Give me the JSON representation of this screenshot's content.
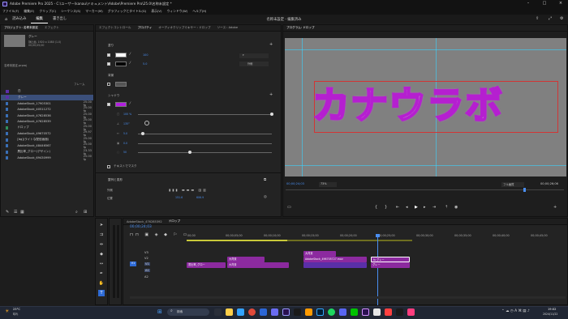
{
  "window": {
    "title": "Adobe Premiere Pro 2025 - C:\\ユーザー\\kanau\\ドキュメント\\Adobe\\Premiere Pro\\25.0\\名称未設定 *"
  },
  "menu": [
    "ファイル(F)",
    "編集(E)",
    "クリップ(C)",
    "シーケンス(S)",
    "マーカー(M)",
    "グラフィックとタイトル(G)",
    "表示(V)",
    "ウィンドウ(W)",
    "ヘルプ(H)"
  ],
  "workspace": {
    "tabs": [
      "読み込み",
      "編集",
      "書き出し"
    ],
    "center_title": "名称未設定 - 編集済み"
  },
  "project": {
    "tabs": [
      "プロジェクト: 名称未設定",
      "エフェクト"
    ],
    "preview_name": "グレー",
    "preview_info": "静止画, 1920 x 1080 (1.0)",
    "preview_duration": "00;00;05;00",
    "project_file": "名称未設定.prproj",
    "col_header": "フレーム",
    "items": [
      {
        "name": "白",
        "fps": "",
        "color": "#5b2fa8"
      },
      {
        "name": "グレー",
        "fps": "",
        "color": "#5b2fa8"
      },
      {
        "name": "AdobeStock_179053015",
        "fps": "25.00 fp",
        "color": "#3a6fb5"
      },
      {
        "name": "AdobeStock_405112725",
        "fps": "25.00 fp",
        "color": "#3a6fb5"
      },
      {
        "name": "AdobeStock_476285361",
        "fps": "25.00 fp",
        "color": "#3a6fb5"
      },
      {
        "name": "AdobeStock_476285392",
        "fps": "25.00 fp",
        "color": "#3a6fb5"
      },
      {
        "name": "ドロップ",
        "fps": "25.00 fp",
        "color": "#2f8f5b"
      },
      {
        "name": "AdobeStock_496705727",
        "fps": "29.97 fp",
        "color": "#3a6fb5"
      },
      {
        "name": "[bg](ライトな配信画面)",
        "fps": "25.00 fp",
        "color": "#3a6fb5"
      },
      {
        "name": "AdobeStock_484465675",
        "fps": "25.00 fp",
        "color": "#3a6fb5"
      },
      {
        "name": "黒比率_グロー(デザイン)",
        "fps": "23.33 fp",
        "color": "#3a6fb5"
      },
      {
        "name": "AdobeStock_694309993",
        "fps": "25.00 fp",
        "color": "#3a6fb5"
      }
    ]
  },
  "effect_controls": {
    "tabs": [
      "エフェクトコントロール",
      "プロパティ",
      "オーディオクリップミキサー : ドロップ",
      "ソース : Adobe"
    ],
    "section_appearance": "塗り",
    "fill_value": "100",
    "stroke_value": "5.0",
    "stroke_style": "外側",
    "bg_label": "背景",
    "shadow_label": "シャドウ",
    "shadow_opacity": "100 %",
    "shadow_angle": "135°",
    "shadow_distance": "5.0",
    "shadow_size": "0.0",
    "shadow_blur": "50",
    "text_mask": "テキストでマスク",
    "transform_label": "整列と変形",
    "position_label": "位置",
    "pos_x": "151.6",
    "pos_y": "606.9",
    "corner_label": "外側"
  },
  "program": {
    "tab": "プログラム: ドロップ",
    "title_text": "カナウラボ",
    "timecode": "00;00;24;03",
    "zoom": "73%",
    "quality": "フル画質",
    "duration": "00;00;26;06"
  },
  "timeline": {
    "tabs": [
      "AdobeStock_476285392",
      "ドロップ"
    ],
    "timecode": "00;00;24;03",
    "ruler": [
      "00;00",
      "00;00;05;00",
      "00;00;10;00",
      "00;00;15;00",
      "00;00;20;00",
      "00;00;25;00",
      "00;00;30;00",
      "00;00;35;00",
      "00;00;40;00",
      "00;00;45;00"
    ],
    "tracks": [
      "V3",
      "V2",
      "V1",
      "A1",
      "A2"
    ],
    "clips": {
      "c1": "黒比率_グロー",
      "c2": "大背景",
      "c3": "大背景",
      "c4": "AdobeStock_496705727.mov",
      "c5": "fx グレー",
      "c6": "グレー"
    }
  },
  "taskbar": {
    "weather_temp": "23°C",
    "weather_desc": "晴れ",
    "search": "検索",
    "time": "19:02",
    "date": "2024/11/22"
  }
}
